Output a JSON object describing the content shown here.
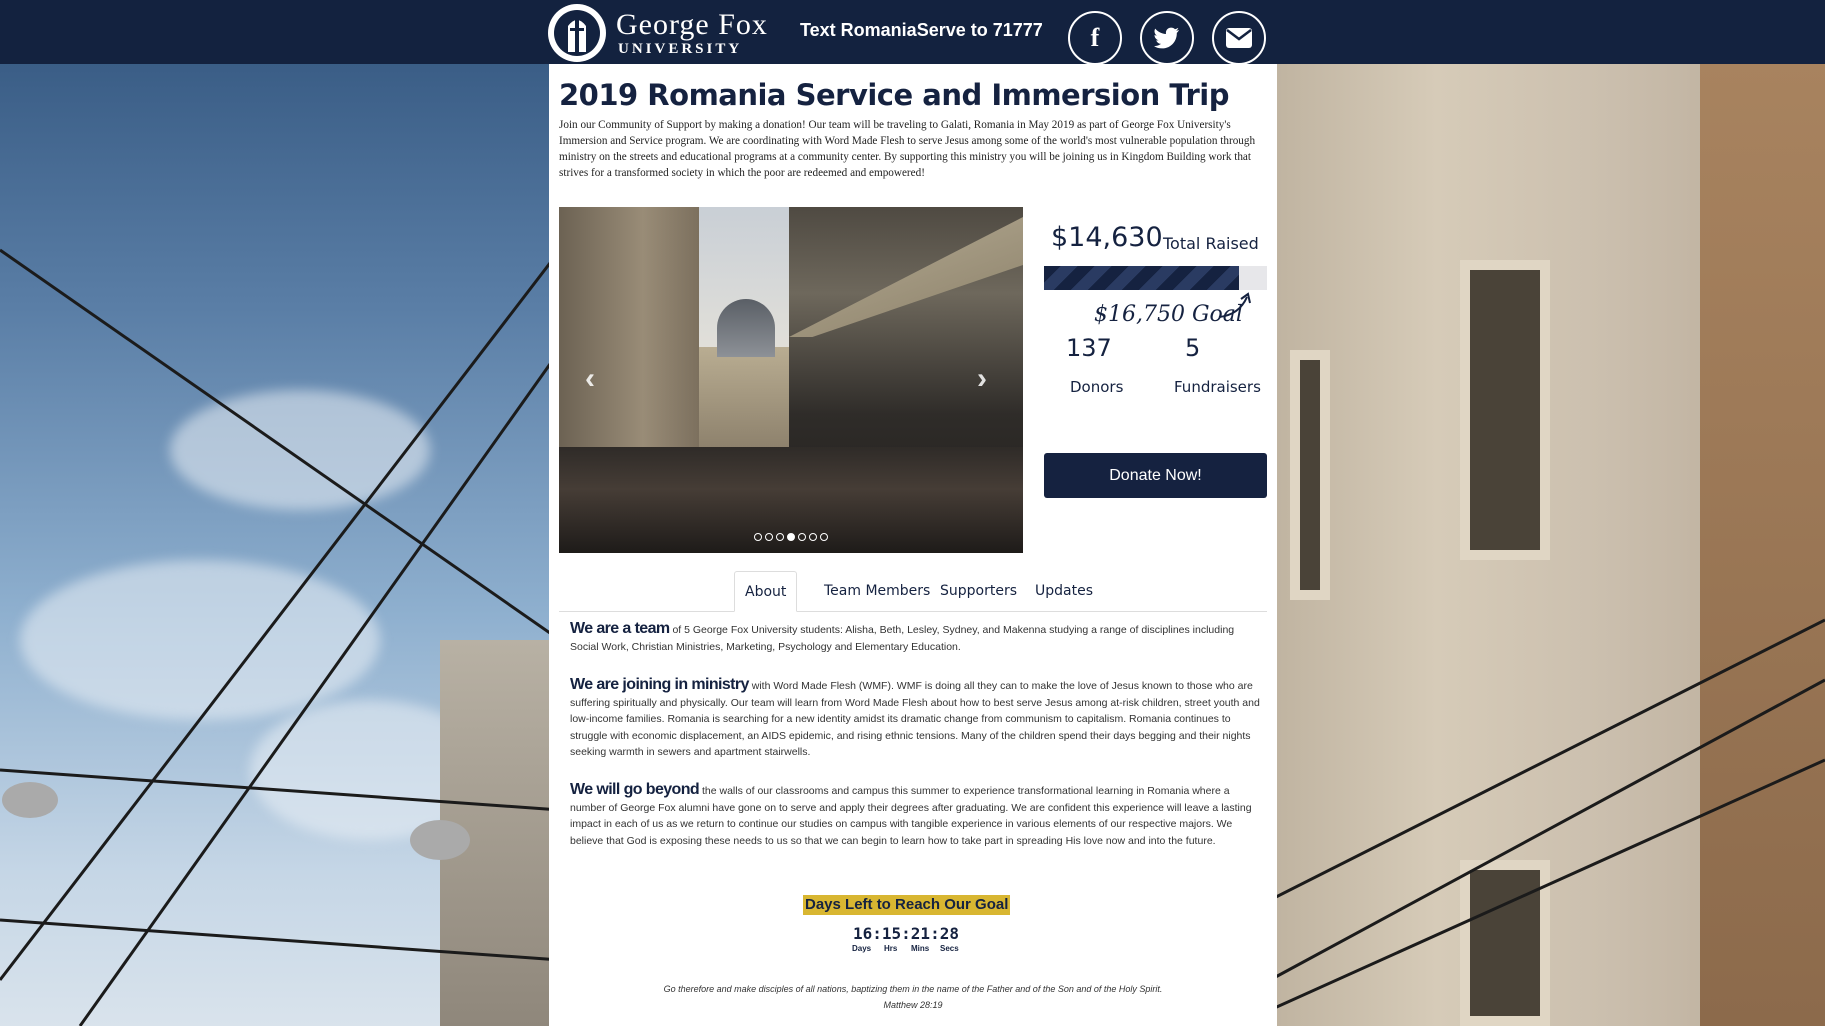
{
  "header": {
    "logo_line1": "George Fox",
    "logo_line2": "UNIVERSITY",
    "text_cta": "Text RomaniaServe to 71777",
    "social": [
      {
        "name": "facebook",
        "glyph": "f"
      },
      {
        "name": "twitter",
        "glyph": "t"
      },
      {
        "name": "email",
        "glyph": "✉"
      }
    ]
  },
  "page": {
    "title": "2019 Romania Service and Immersion Trip",
    "intro": "Join our Community of Support by making a donation! Our team will be traveling to Galati, Romania in May 2019 as part of George Fox University's Immersion and Service program. We are coordinating with Word Made Flesh to serve Jesus among some of the world's most vulnerable population through ministry on the streets and educational programs at a community center. By supporting this ministry you will be joining us in Kingdom Building work that strives for a transformed society in which the poor are redeemed and empowered!"
  },
  "carousel": {
    "prev_glyph": "‹",
    "next_glyph": "›",
    "slide_count": 7,
    "active_index": 3
  },
  "fundraising": {
    "raised": "$14,630",
    "raised_label": "Total Raised",
    "progress_fraction": 0.873,
    "goal_text": "$16,750 Goal",
    "donors": "137",
    "donors_label": "Donors",
    "fundraisers": "5",
    "fundraisers_label": "Fundraisers",
    "donate_label": "Donate Now!"
  },
  "tabs": [
    "About",
    "Team Members",
    "Supporters",
    "Updates"
  ],
  "about": {
    "p1_lead": "We are a team",
    "p1_text": " of 5 George Fox University students: Alisha, Beth, Lesley, Sydney, and Makenna studying a range of disciplines including Social Work, Christian Ministries, Marketing, Psychology and Elementary Education.",
    "p2_lead": "We are joining in ministry",
    "p2_text": " with Word Made Flesh (WMF).  WMF is doing all they can to make the love of Jesus known to those who are suffering spiritually and physically.  Our team will learn from Word Made Flesh about how to best serve Jesus among at-risk children, street youth and low-income families.  Romania is searching for a new identity amidst its dramatic change from communism to capitalism.  Romania continues to struggle with economic displacement, an AIDS epidemic, and rising ethnic tensions.  Many of the children spend their days begging and their nights seeking warmth in sewers and apartment stairwells.",
    "p3_lead": "We will go beyond",
    "p3_text": " the walls of our classrooms and campus this summer to experience transformational learning in Romania where a number of George Fox alumni have gone on to serve and apply their degrees after graduating.  We are confident this experience will leave a lasting impact in each of us as we return to continue our studies on campus with tangible experience in various elements of our respective majors.  We believe that God is exposing these needs to us so that we can begin to learn how to take part in spreading His love now and into the future."
  },
  "countdown": {
    "label": "Days Left to Reach Our Goal",
    "value": "16:15:21:28",
    "units": [
      "Days",
      "Hrs",
      "Mins",
      "Secs"
    ]
  },
  "verse": {
    "text": "Go therefore and make disciples of all nations, baptizing them in the name of the Father and of the Son and of the Holy Spirit.",
    "ref": "Matthew 28:19"
  },
  "colors": {
    "navy": "#13223f",
    "accent_gold": "#d8b631"
  }
}
